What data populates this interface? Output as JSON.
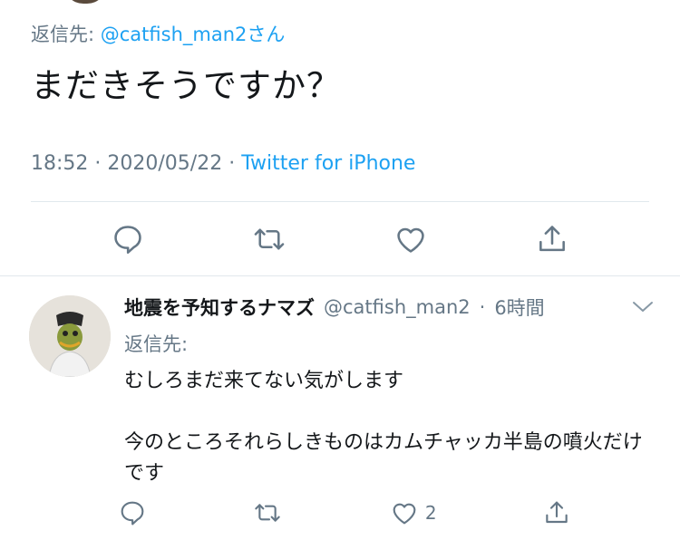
{
  "tweet": {
    "reply_to_label": "返信先:",
    "reply_to_handle": "@catfish_man2さん",
    "text": "まだきそうですか？",
    "time": "18:52",
    "date": "2020/05/22",
    "separator": "·",
    "source": "Twitter for iPhone"
  },
  "reply": {
    "name": "地震を予知するナマズ",
    "handle": "@catfish_man2",
    "separator": "·",
    "age": "6時間",
    "reply_to_label": "返信先:",
    "line1": "むしろまだ来てない気がします",
    "line2": "今のところそれらしきものはカムチャッカ半島の噴火だけです",
    "like_count": "2"
  },
  "icons": [
    "reply-icon",
    "retweet-icon",
    "like-icon",
    "share-icon",
    "chevron-down-icon"
  ],
  "colors": {
    "link": "#1da1f2",
    "muted": "#657786",
    "text": "#14171a",
    "divider": "#e1e8ed"
  }
}
